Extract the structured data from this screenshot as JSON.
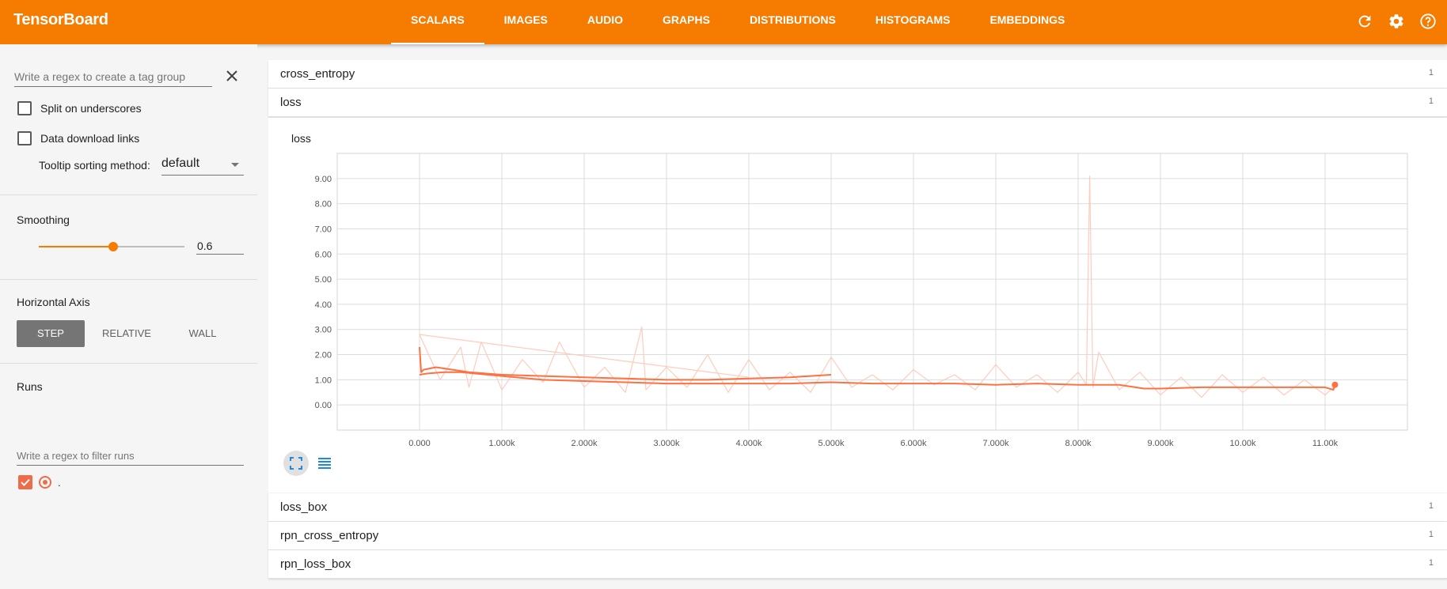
{
  "app": {
    "title": "TensorBoard"
  },
  "tabs": [
    {
      "label": "SCALARS",
      "active": true
    },
    {
      "label": "IMAGES"
    },
    {
      "label": "AUDIO"
    },
    {
      "label": "GRAPHS"
    },
    {
      "label": "DISTRIBUTIONS"
    },
    {
      "label": "HISTOGRAMS"
    },
    {
      "label": "EMBEDDINGS"
    }
  ],
  "toolbar_icons": [
    "refresh-icon",
    "settings-icon",
    "help-icon"
  ],
  "sidebar": {
    "tag_regex_placeholder": "Write a regex to create a tag group",
    "split_underscores": "Split on underscores",
    "data_download_links": "Data download links",
    "tooltip_sorting_label": "Tooltip sorting method:",
    "tooltip_sorting_value": "default",
    "smoothing_title": "Smoothing",
    "smoothing_value": "0.6",
    "smoothing_level": 0.6,
    "horizontal_axis_title": "Horizontal Axis",
    "axis_options": [
      "STEP",
      "RELATIVE",
      "WALL"
    ],
    "axis_selected": "STEP",
    "runs_title": "Runs",
    "run_filter_placeholder": "Write a regex to filter runs",
    "runs": [
      {
        "name": ".",
        "checked": true,
        "color": "#ef6c48"
      }
    ]
  },
  "categories": [
    {
      "name": "cross_entropy",
      "count": "1"
    },
    {
      "name": "loss",
      "count": "1",
      "expanded": true
    },
    {
      "name": "loss_box",
      "count": "1"
    },
    {
      "name": "rpn_cross_entropy",
      "count": "1"
    },
    {
      "name": "rpn_loss_box",
      "count": "1"
    }
  ],
  "colors": {
    "accent": "#f57c00",
    "run": "#ff7043",
    "run_faint": "#ffccbc"
  },
  "chart_data": {
    "type": "line",
    "title": "loss",
    "xlabel": "",
    "ylabel": "",
    "xlim": [
      -1000,
      12000
    ],
    "ylim": [
      -1,
      10
    ],
    "x_ticks": [
      "0.000",
      "1.000k",
      "2.000k",
      "3.000k",
      "4.000k",
      "5.000k",
      "6.000k",
      "7.000k",
      "8.000k",
      "9.000k",
      "10.00k",
      "11.00k"
    ],
    "x_tick_values": [
      0,
      1000,
      2000,
      3000,
      4000,
      5000,
      6000,
      7000,
      8000,
      9000,
      10000,
      11000
    ],
    "y_ticks": [
      "0.00",
      "1.00",
      "2.00",
      "3.00",
      "4.00",
      "5.00",
      "6.00",
      "7.00",
      "8.00",
      "9.00"
    ],
    "y_tick_values": [
      0,
      1,
      2,
      3,
      4,
      5,
      6,
      7,
      8,
      9
    ],
    "grid": true,
    "series": [
      {
        "role": "smoothed",
        "x": [
          0,
          20,
          50,
          200,
          400,
          600,
          1000,
          1500,
          2000,
          2500,
          3000,
          3500,
          4000,
          4500,
          5000
        ],
        "y": [
          2.3,
          1.3,
          1.4,
          1.5,
          1.4,
          1.3,
          1.2,
          1.15,
          1.1,
          1.05,
          1.0,
          1.0,
          1.05,
          1.1,
          1.2
        ]
      },
      {
        "role": "smoothed",
        "x": [
          0,
          100,
          300,
          500,
          1000,
          1500,
          2000,
          2500,
          3000,
          3500,
          4000,
          4500,
          5000,
          5500,
          6000,
          6500,
          7000,
          7500,
          8000,
          8500,
          8800,
          9000,
          9500,
          10000,
          10500,
          11000,
          11100,
          11120
        ],
        "y": [
          1.2,
          1.25,
          1.3,
          1.3,
          1.15,
          1.0,
          0.95,
          0.9,
          0.85,
          0.85,
          0.85,
          0.85,
          0.9,
          0.85,
          0.85,
          0.85,
          0.8,
          0.85,
          0.8,
          0.8,
          0.65,
          0.65,
          0.7,
          0.7,
          0.7,
          0.7,
          0.6,
          0.8
        ]
      },
      {
        "role": "raw",
        "x": [
          0,
          250,
          500,
          600,
          750,
          1000,
          1250,
          1500,
          1700,
          2000,
          2250,
          2500,
          2700,
          2750,
          3000,
          3250,
          3500,
          3750,
          4000,
          4250,
          4500,
          4750,
          5000,
          5250,
          5500,
          5750,
          6000,
          6250,
          6500,
          6750,
          7000,
          7250,
          7500,
          7750,
          8000,
          8100,
          8140,
          8180,
          8250,
          8500,
          8750,
          9000,
          9250,
          9500,
          9750,
          10000,
          10250,
          10500,
          10750,
          11000,
          11100
        ],
        "y": [
          2.8,
          1.0,
          2.3,
          0.7,
          2.5,
          0.6,
          1.8,
          0.9,
          2.5,
          0.7,
          1.5,
          0.5,
          3.1,
          0.6,
          1.5,
          0.7,
          2.0,
          0.5,
          1.8,
          0.6,
          1.3,
          0.5,
          1.9,
          0.7,
          1.2,
          0.6,
          1.4,
          0.8,
          1.2,
          0.6,
          1.6,
          0.7,
          1.2,
          0.5,
          1.3,
          0.8,
          9.1,
          0.7,
          2.1,
          0.6,
          1.3,
          0.4,
          1.1,
          0.3,
          1.2,
          0.5,
          1.1,
          0.4,
          1.0,
          0.4,
          0.7
        ]
      },
      {
        "role": "raw",
        "x": [
          0,
          4000
        ],
        "y": [
          2.8,
          1.1
        ]
      }
    ]
  }
}
